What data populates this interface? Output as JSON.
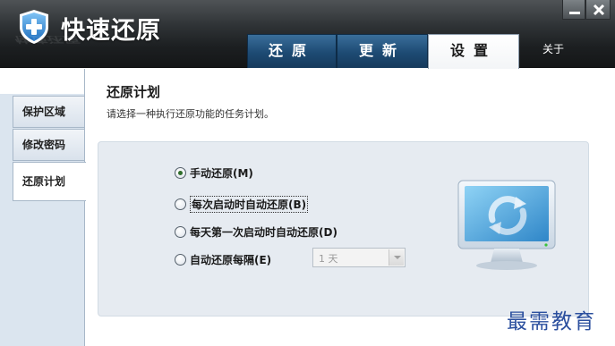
{
  "app": {
    "title": "快速还原",
    "title_reflection": "快速还原"
  },
  "tabs": [
    {
      "label": "还原",
      "active": false
    },
    {
      "label": "更新",
      "active": false
    },
    {
      "label": "设置",
      "active": true
    }
  ],
  "about_label": "关于",
  "sidebar": {
    "items": [
      {
        "label": "保护区域",
        "active": false
      },
      {
        "label": "修改密码",
        "active": false
      },
      {
        "label": "还原计划",
        "active": true
      }
    ]
  },
  "section": {
    "title": "还原计划",
    "description": "请选择一种执行还原功能的任务计划。"
  },
  "options": [
    {
      "label": "手动还原(M)",
      "checked": true
    },
    {
      "label": "每次启动时自动还原(B)",
      "checked": false
    },
    {
      "label": "每天第一次启动时自动还原(D)",
      "checked": false
    },
    {
      "label": "自动还原每隔(E)",
      "checked": false
    }
  ],
  "interval_select": {
    "value": "1 天",
    "disabled": true
  },
  "watermark": "最需教育",
  "colors": {
    "header_dark": "#1c1f21",
    "tab_blue": "#1d4a73",
    "sidebar_bg": "#dbe5ef",
    "panel_bg": "#e6ebf1",
    "watermark": "#2b4f9e"
  }
}
